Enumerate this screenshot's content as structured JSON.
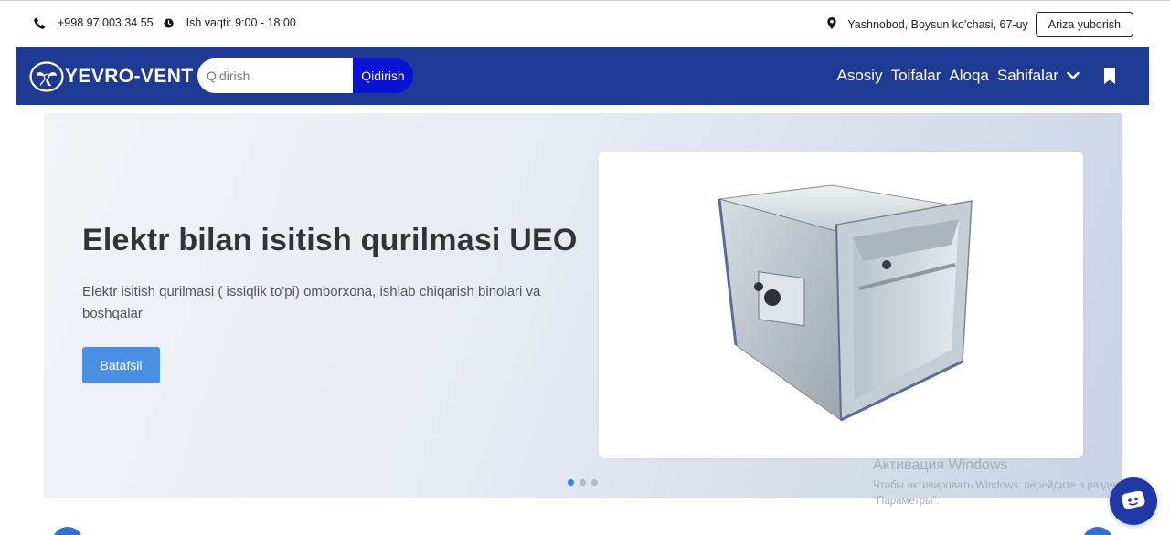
{
  "topbar": {
    "phone": "+998 97 003 34 55",
    "hours": "Ish vaqti: 9:00 - 18:00",
    "address": "Yashnobod, Boysun ko'chasi, 67-uy",
    "request_button": "Ariza yuborish",
    "icons": [
      "phone-icon",
      "clock-icon",
      "location-pin-icon"
    ]
  },
  "navbar": {
    "logo_text": "YEVRO-VENT",
    "search_placeholder": "Qidirish",
    "search_button": "Qidirish",
    "links": [
      "Asosiy",
      "Toifalar",
      "Aloqa",
      "Sahifalar"
    ],
    "background_color": "#1f3a93",
    "search_button_color": "#0a12d6"
  },
  "hero": {
    "title": "Elektr bilan isitish qurilmasi UEO",
    "description": "Elektr isitish qurilmasi ( issiqlik to'pi) omborxona, ishlab chiqarish binolari va boshqalar",
    "button": "Batafsil",
    "button_color": "#4a90e2",
    "slides_count": 3,
    "active_slide": 1
  },
  "watermark": {
    "title": "Активация Windows",
    "text": "Чтобы активировать Windows, перейдите в раздел \"Параметры\"."
  },
  "chat_widget": {
    "icon": "chat-bubble-icon",
    "color": "#1f3aa8"
  }
}
